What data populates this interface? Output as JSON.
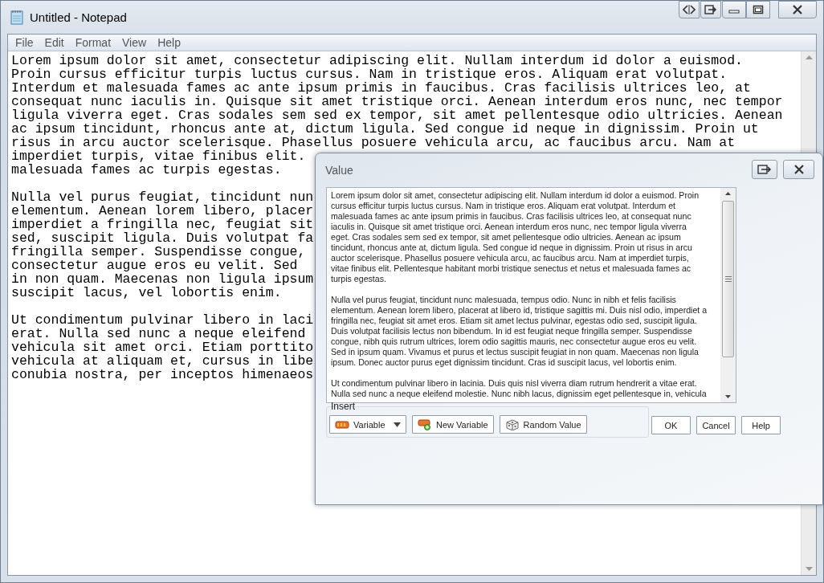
{
  "notepad": {
    "title": "Untitled - Notepad",
    "menu": [
      "File",
      "Edit",
      "Format",
      "View",
      "Help"
    ],
    "paragraphs": [
      [
        "Lorem ipsum dolor sit amet, consectetur adipiscing elit. Nullam interdum id dolor a euismod.",
        "Proin cursus efficitur turpis luctus cursus. Nam in tristique eros. Aliquam erat volutpat.",
        "Interdum et malesuada fames ac ante ipsum primis in faucibus. Cras facilisis ultrices leo, at",
        "consequat nunc iaculis in. Quisque sit amet tristique orci. Aenean interdum eros nunc, nec tempor",
        "ligula viverra eget. Cras sodales sem sed ex tempor, sit amet pellentesque odio ultricies. Aenean",
        "ac ipsum tincidunt, rhoncus ante at, dictum ligula. Sed congue id neque in dignissim. Proin ut",
        "risus in arcu auctor scelerisque. Phasellus posuere vehicula arcu, ac faucibus arcu. Nam at",
        "imperdiet turpis, vitae finibus elit.",
        "malesuada fames ac turpis egestas."
      ],
      [
        "Nulla vel purus feugiat, tincidunt nun",
        "elementum. Aenean lorem libero, placer",
        "imperdiet a fringilla nec, feugiat sit",
        "sed, suscipit ligula. Duis volutpat fa",
        "fringilla semper. Suspendisse congue,",
        "consectetur augue eros eu velit. Sed",
        "in non quam. Maecenas non ligula ipsum",
        "suscipit lacus, vel lobortis enim."
      ],
      [
        "Ut condimentum pulvinar libero in laci",
        "erat. Nulla sed nunc a neque eleifend",
        "vehicula sit amet orci. Etiam porttito",
        "vehicula at aliquam et, cursus in libe",
        "conubia nostra, per inceptos himenaeos"
      ]
    ]
  },
  "dialog": {
    "title": "Value",
    "paragraphs": [
      [
        "Lorem ipsum dolor sit amet, consectetur adipiscing elit. Nullam interdum id dolor a euismod. Proin",
        "cursus efficitur turpis luctus cursus. Nam in tristique eros. Aliquam erat volutpat. Interdum et",
        "malesuada fames ac ante ipsum primis in faucibus. Cras facilisis ultrices leo, at consequat nunc",
        "iaculis in. Quisque sit amet tristique orci. Aenean interdum eros nunc, nec tempor ligula viverra",
        "eget. Cras sodales sem sed ex tempor, sit amet pellentesque odio ultricies. Aenean ac ipsum",
        "tincidunt, rhoncus ante at, dictum ligula. Sed congue id neque in dignissim. Proin ut risus in arcu",
        "auctor scelerisque. Phasellus posuere vehicula arcu, ac faucibus arcu. Nam at imperdiet turpis,",
        "vitae finibus elit. Pellentesque habitant morbi tristique senectus et netus et malesuada fames ac",
        "turpis egestas."
      ],
      [
        "Nulla vel purus feugiat, tincidunt nunc malesuada, tempus odio. Nunc in nibh et felis facilisis",
        "elementum. Aenean lorem libero, placerat at libero id, tristique sagittis mi. Duis nisl odio, imperdiet a",
        "fringilla nec, feugiat sit amet eros. Etiam sit amet lectus pulvinar, egestas odio sed, suscipit ligula.",
        "Duis volutpat facilisis lectus non bibendum. In id est feugiat neque fringilla semper. Suspendisse",
        "congue, nibh quis rutrum ultrices, lorem odio sagittis mauris, nec consectetur augue eros eu velit.",
        "Sed in ipsum quam. Vivamus et purus et lectus suscipit feugiat in non quam. Maecenas non ligula",
        "ipsum. Donec auctor purus eget dignissim tincidunt. Cras id suscipit lacus, vel lobortis enim."
      ],
      [
        "Ut condimentum pulvinar libero in lacinia. Duis quis nisl viverra diam rutrum hendrerit a vitae erat.",
        "Nulla sed nunc a neque eleifend molestie. Nunc nibh lacus, dignissim eget pellentesque in, vehicula"
      ]
    ],
    "insert_group": {
      "label": "Insert",
      "controls": [
        {
          "kind": "dropdown",
          "label": "Variable"
        },
        {
          "kind": "add",
          "label": "New Variable"
        },
        {
          "kind": "random",
          "label": "Random Value"
        }
      ]
    },
    "buttons": [
      "OK",
      "Cancel",
      "Help"
    ]
  }
}
